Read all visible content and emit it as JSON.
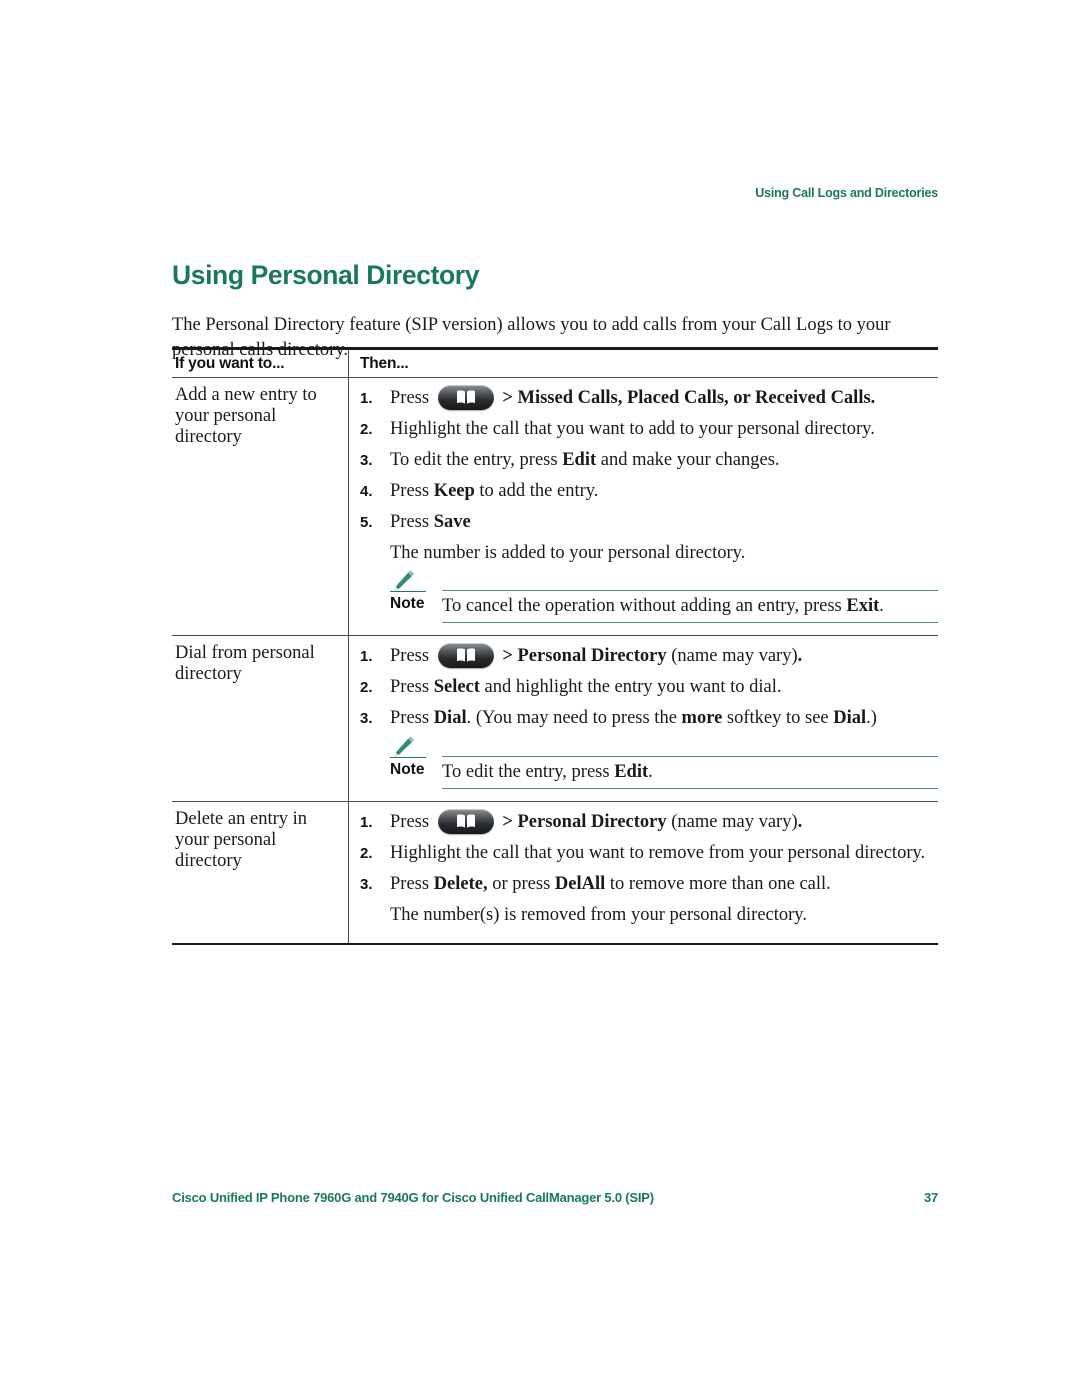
{
  "header": {
    "running_head": "Using Call Logs and Directories"
  },
  "title": "Using Personal Directory",
  "intro": "The Personal Directory feature (SIP version) allows you to add calls from your Call Logs to your personal calls directory.",
  "table": {
    "columns": [
      "If you want to...",
      "Then..."
    ],
    "rows": [
      {
        "condition": "Add a new entry to your personal directory",
        "steps": [
          {
            "num": "1.",
            "html": "Press <span class=\"key-icon\" data-name=\"directories-key-icon\" data-interactable=\"true\"><svg class=\"book\" viewBox=\"0 0 20 15\" xmlns=\"http://www.w3.org/2000/svg\"><path d=\"M1 1.6 C3.3 0.6 6.4 0.6 9 2 L9 14 C6.4 12.7 3.3 12.7 1 13.6 Z\" fill=\"#ffffff\"/><path d=\"M19 1.6 C16.7 0.6 13.6 0.6 11 2 L11 14 C13.6 12.7 16.7 12.7 19 13.6 Z\" fill=\"#ffffff\"/></svg></span> <b>&gt; Missed Calls, Placed Calls, or Received Calls.</b>"
          },
          {
            "num": "2.",
            "html": "Highlight the call that you want to add to your personal directory."
          },
          {
            "num": "3.",
            "html": "To edit the entry, press <b>Edit</b> and make your changes."
          },
          {
            "num": "4.",
            "html": "Press <b>Keep</b> to add the entry."
          },
          {
            "num": "5.",
            "html": "Press <b>Save</b>"
          }
        ],
        "result": "The number is added to your personal directory.",
        "note": {
          "label": "Note",
          "html": "To cancel the operation without adding an entry, press <b>Exit</b>."
        }
      },
      {
        "condition": "Dial from personal directory",
        "steps": [
          {
            "num": "1.",
            "html": "Press <span class=\"key-icon\" data-name=\"directories-key-icon\" data-interactable=\"true\"><svg class=\"book\" viewBox=\"0 0 20 15\" xmlns=\"http://www.w3.org/2000/svg\"><path d=\"M1 1.6 C3.3 0.6 6.4 0.6 9 2 L9 14 C6.4 12.7 3.3 12.7 1 13.6 Z\" fill=\"#ffffff\"/><path d=\"M19 1.6 C16.7 0.6 13.6 0.6 11 2 L11 14 C13.6 12.7 16.7 12.7 19 13.6 Z\" fill=\"#ffffff\"/></svg></span> <b>&gt; Personal Directory</b> (name may vary)<b>.</b>"
          },
          {
            "num": "2.",
            "html": "Press <b>Select</b> and highlight the entry you want to dial."
          },
          {
            "num": "3.",
            "html": "Press <b>Dial</b>. (You may need to press the <b>more</b> softkey to see <b>Dial</b>.)"
          }
        ],
        "result": "",
        "note": {
          "label": "Note",
          "html": "To edit the entry, press <b>Edit</b>."
        }
      },
      {
        "condition": "Delete an entry in your personal directory",
        "steps": [
          {
            "num": "1.",
            "html": "Press <span class=\"key-icon\" data-name=\"directories-key-icon\" data-interactable=\"true\"><svg class=\"book\" viewBox=\"0 0 20 15\" xmlns=\"http://www.w3.org/2000/svg\"><path d=\"M1 1.6 C3.3 0.6 6.4 0.6 9 2 L9 14 C6.4 12.7 3.3 12.7 1 13.6 Z\" fill=\"#ffffff\"/><path d=\"M19 1.6 C16.7 0.6 13.6 0.6 11 2 L11 14 C13.6 12.7 16.7 12.7 19 13.6 Z\" fill=\"#ffffff\"/></svg></span> <b>&gt; Personal Directory</b> (name may vary)<b>.</b>"
          },
          {
            "num": "2.",
            "html": "Highlight the call that you want to remove from your personal directory."
          },
          {
            "num": "3.",
            "html": "Press <b>Delete,</b> or press <b>DelAll</b> to remove more than one call."
          }
        ],
        "result": "The number(s) is removed from your personal directory.",
        "note": null
      }
    ]
  },
  "footer": {
    "document_title": "Cisco Unified IP Phone 7960G and 7940G for Cisco Unified CallManager 5.0 (SIP)",
    "page_number": "37"
  },
  "colors": {
    "cisco_green": "#1a7a55",
    "note_rule_green": "#4d8f72",
    "rule_black": "#1a1a1a"
  }
}
